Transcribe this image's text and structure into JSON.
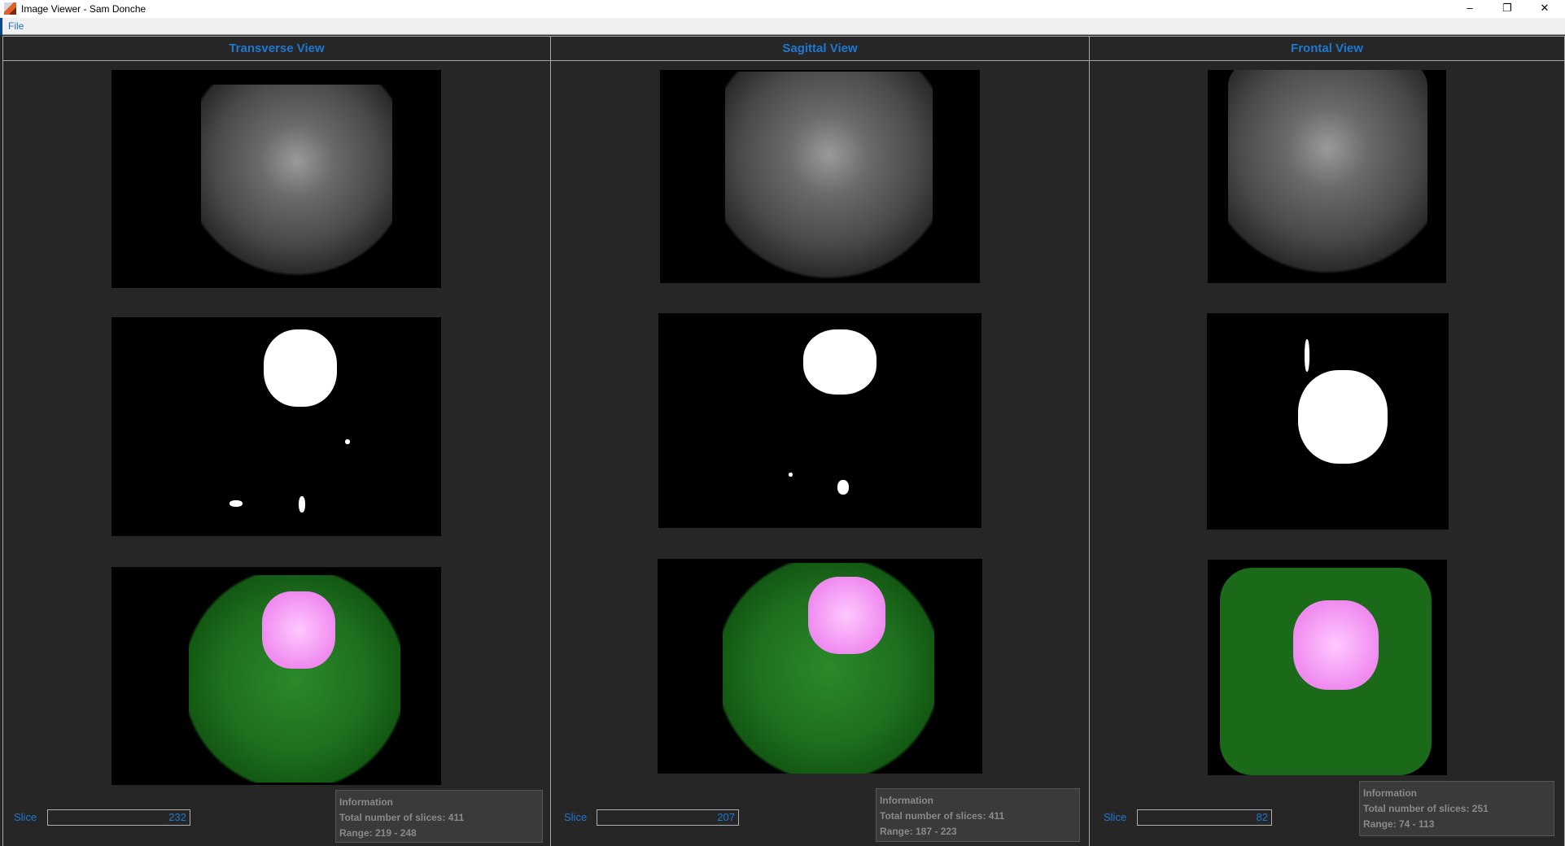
{
  "window": {
    "title": "Image Viewer - Sam Donche",
    "minimize": "–",
    "restore": "❐",
    "close": "✕"
  },
  "menu": {
    "file": "File"
  },
  "views": [
    {
      "title": "Transverse View",
      "slice_label": "Slice",
      "slice_value": "232",
      "info_title": "Information",
      "info_total": "Total number of slices: 411",
      "info_range": "Range: 219 - 248"
    },
    {
      "title": "Sagittal View",
      "slice_label": "Slice",
      "slice_value": "207",
      "info_title": "Information",
      "info_total": "Total number of slices: 411",
      "info_range": "Range: 187 - 223"
    },
    {
      "title": "Frontal View",
      "slice_label": "Slice",
      "slice_value": "82",
      "info_title": "Information",
      "info_total": "Total number of slices: 251",
      "info_range": "Range: 74 - 113"
    }
  ]
}
